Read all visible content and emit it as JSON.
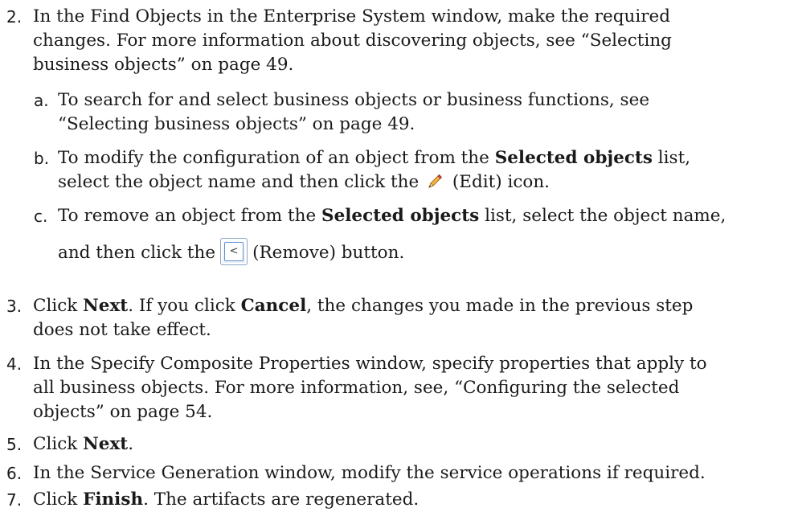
{
  "steps": [
    {
      "num": "2.",
      "lines": [
        "In the Find Objects in the Enterprise System window, make the required",
        "changes. For more information about discovering objects, see “Selecting",
        "business objects” on page 49."
      ],
      "substeps": [
        {
          "num": "a.",
          "lines": [
            "To search for and select business objects or business functions, see",
            "“Selecting business objects” on page 49."
          ]
        },
        {
          "num": "b.",
          "line1_pre": "To modify the configuration of an object from the ",
          "line1_bold": "Selected objects",
          "line1_post": " list,",
          "line2_pre": "select the object name and then click the",
          "line2_post": "(Edit) icon.",
          "icon": "edit-pencil-icon"
        },
        {
          "num": "c.",
          "line1_pre": "To remove an object from the ",
          "line1_bold": "Selected objects",
          "line1_post": " list, select the object name,",
          "line2_pre": "and then click the",
          "line2_post": "(Remove) button.",
          "button_glyph": "<",
          "icon": "remove-arrow-button"
        }
      ]
    },
    {
      "num": "3.",
      "line1_pre": "Click ",
      "line1_bold": "Next",
      "line1_mid": ". If you click ",
      "line1_bold2": "Cancel",
      "line1_post": ", the changes you made in the previous step",
      "line2": "does not take effect."
    },
    {
      "num": "4.",
      "lines": [
        "In the Specify Composite Properties window, specify properties that apply to",
        "all business objects. For more information, see, “Configuring the selected",
        "objects” on page 54."
      ]
    },
    {
      "num": "5.",
      "pre": "Click ",
      "bold": "Next",
      "post": "."
    },
    {
      "num": "6.",
      "text": "In the Service Generation window, modify the service operations if required."
    },
    {
      "num": "7.",
      "pre": "Click ",
      "bold": "Finish",
      "post": ". The artifacts are regenerated."
    }
  ]
}
